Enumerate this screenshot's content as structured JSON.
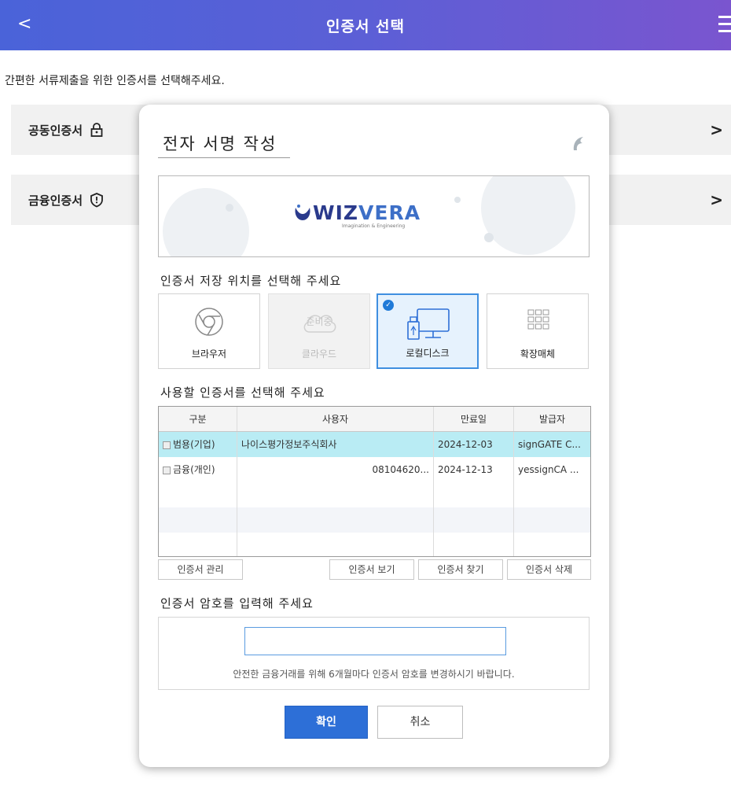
{
  "header": {
    "back_glyph": "<",
    "title": "인증서 선택"
  },
  "intro_text": "간편한 서류제출을 위한 인증서를 선택해주세요.",
  "cert_types": [
    {
      "label": "공동인증서",
      "icon": "lock-icon",
      "chevron": ">"
    },
    {
      "label": "금융인증서",
      "icon": "shield-icon",
      "chevron": ">"
    }
  ],
  "dialog": {
    "title": "전자 서명 작성",
    "banner": {
      "brand": "WIZVERA",
      "brand_bold": "WIZ",
      "brand_light": "VERA",
      "tagline": "Imagination & Engineering"
    },
    "storage_label": "인증서 저장 위치를 선택해 주세요",
    "storage_options": [
      {
        "label": "브라우저",
        "state": "normal",
        "icon": "chrome-icon"
      },
      {
        "label": "클라우드",
        "state": "disabled",
        "badge": "준비중",
        "icon": "cloud-icon"
      },
      {
        "label": "로컬디스크",
        "state": "selected",
        "icon": "local-disk-icon"
      },
      {
        "label": "확장매체",
        "state": "normal",
        "icon": "grid-icon"
      }
    ],
    "cert_list_label": "사용할 인증서를 선택해 주세요",
    "table": {
      "columns": [
        "구분",
        "사용자",
        "만료일",
        "발급자"
      ],
      "rows": [
        {
          "type": "범용(기업)",
          "user": "나이스평가정보주식회사",
          "expiry": "2024-12-03",
          "issuer": "signGATE C..."
        },
        {
          "type": "금융(개인)",
          "user": "081046​20...",
          "expiry": "2024-12-13",
          "issuer": "yessignCA ..."
        }
      ]
    },
    "table_buttons": {
      "manage": "인증서 관리",
      "view": "인증서 보기",
      "find": "인증서 찾기",
      "delete": "인증서 삭제"
    },
    "password_label": "인증서 암호를 입력해 주세요",
    "password_value": "",
    "password_note": "안전한 금융거래를 위해 6개월마다 인증서 암호를 변경하시기 바랍니다.",
    "confirm": "확인",
    "cancel": "취소"
  },
  "colors": {
    "header_start": "#4a63d9",
    "header_end": "#7a55cf",
    "selected_row": "#b9ecf4",
    "confirm_button": "#2d6fd7"
  }
}
